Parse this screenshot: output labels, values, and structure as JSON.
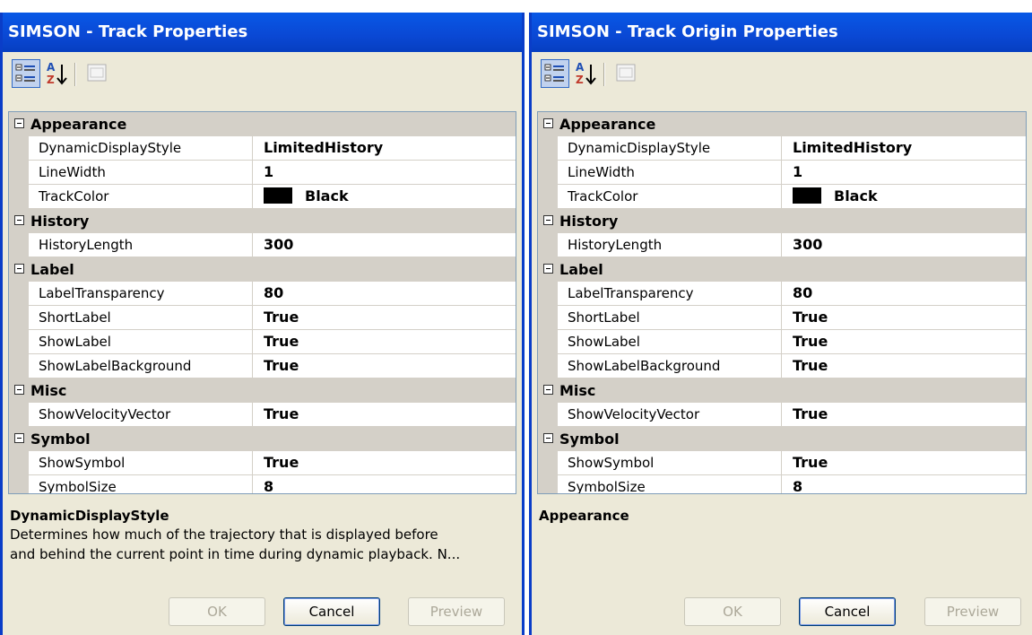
{
  "dialogs": [
    {
      "title": "SIMSON - Track Properties",
      "rows": [
        {
          "type": "category",
          "label": "Appearance"
        },
        {
          "type": "prop",
          "name": "DynamicDisplayStyle",
          "value": "LimitedHistory"
        },
        {
          "type": "prop",
          "name": "LineWidth",
          "value": "1"
        },
        {
          "type": "prop",
          "name": "TrackColor",
          "value": "Black",
          "color": "#000000"
        },
        {
          "type": "category",
          "label": "History"
        },
        {
          "type": "prop",
          "name": "HistoryLength",
          "value": "300"
        },
        {
          "type": "category",
          "label": "Label"
        },
        {
          "type": "prop",
          "name": "LabelTransparency",
          "value": "80"
        },
        {
          "type": "prop",
          "name": "ShortLabel",
          "value": "True"
        },
        {
          "type": "prop",
          "name": "ShowLabel",
          "value": "True"
        },
        {
          "type": "prop",
          "name": "ShowLabelBackground",
          "value": "True"
        },
        {
          "type": "category",
          "label": "Misc"
        },
        {
          "type": "prop",
          "name": "ShowVelocityVector",
          "value": "True"
        },
        {
          "type": "category",
          "label": "Symbol"
        },
        {
          "type": "prop",
          "name": "ShowSymbol",
          "value": "True"
        },
        {
          "type": "prop",
          "name": "SymbolSize",
          "value": "8"
        }
      ],
      "description": {
        "title": "DynamicDisplayStyle",
        "lines": [
          "Determines how much of the trajectory that is displayed before",
          "and behind the current point in time during dynamic playback. N..."
        ]
      },
      "buttons": {
        "ok": "OK",
        "cancel": "Cancel",
        "preview": "Preview"
      }
    },
    {
      "title": "SIMSON - Track Origin Properties",
      "rows": [
        {
          "type": "category",
          "label": "Appearance"
        },
        {
          "type": "prop",
          "name": "DynamicDisplayStyle",
          "value": "LimitedHistory"
        },
        {
          "type": "prop",
          "name": "LineWidth",
          "value": "1"
        },
        {
          "type": "prop",
          "name": "TrackColor",
          "value": "Black",
          "color": "#000000"
        },
        {
          "type": "category",
          "label": "History"
        },
        {
          "type": "prop",
          "name": "HistoryLength",
          "value": "300"
        },
        {
          "type": "category",
          "label": "Label"
        },
        {
          "type": "prop",
          "name": "LabelTransparency",
          "value": "80"
        },
        {
          "type": "prop",
          "name": "ShortLabel",
          "value": "True"
        },
        {
          "type": "prop",
          "name": "ShowLabel",
          "value": "True"
        },
        {
          "type": "prop",
          "name": "ShowLabelBackground",
          "value": "True"
        },
        {
          "type": "category",
          "label": "Misc"
        },
        {
          "type": "prop",
          "name": "ShowVelocityVector",
          "value": "True"
        },
        {
          "type": "category",
          "label": "Symbol"
        },
        {
          "type": "prop",
          "name": "ShowSymbol",
          "value": "True"
        },
        {
          "type": "prop",
          "name": "SymbolSize",
          "value": "8"
        }
      ],
      "description": {
        "title": "Appearance",
        "lines": []
      },
      "buttons": {
        "ok": "OK",
        "cancel": "Cancel",
        "preview": "Preview"
      }
    }
  ],
  "toolbar_icons": [
    "categorized-icon",
    "alphabetical-sort-icon",
    "property-pages-icon"
  ],
  "colors": {
    "titlebar": "#0a48d4",
    "dialog_bg": "#ece9d8",
    "category_bg": "#d4d0c8"
  }
}
